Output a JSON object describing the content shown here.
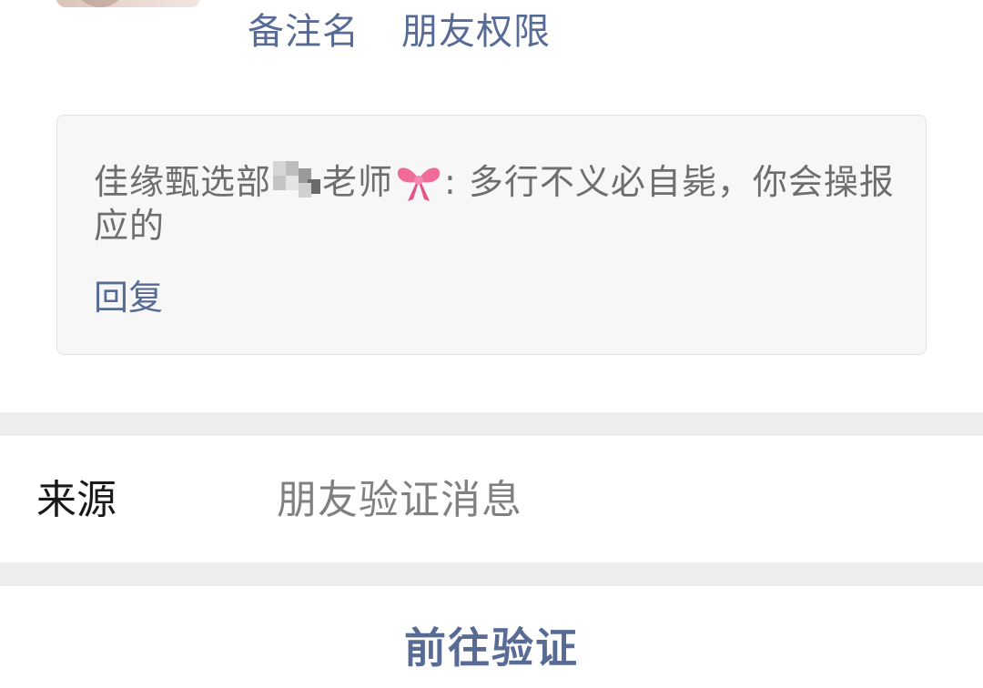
{
  "contact_actions": {
    "remark_name": "备注名",
    "friend_permissions": "朋友权限"
  },
  "verification_message": {
    "sender_prefix": "佳缘甄选部",
    "sender_suffix": "老师",
    "separator": ":",
    "text": " 多行不义必自毙，你会操报应的",
    "redacted_mosaic_icon": "mosaic-blur",
    "emoji_icon": "pink-ribbon-bow",
    "reply_label": "回复"
  },
  "source": {
    "label": "来源",
    "value": "朋友验证消息"
  },
  "verify": {
    "button_label": "前往验证"
  },
  "colors": {
    "link_blue": "#576b95",
    "card_background": "#f7f7f7",
    "separator_gray": "#ededed",
    "secondary_text": "#808080",
    "bow_pink": "#f06a9a"
  }
}
